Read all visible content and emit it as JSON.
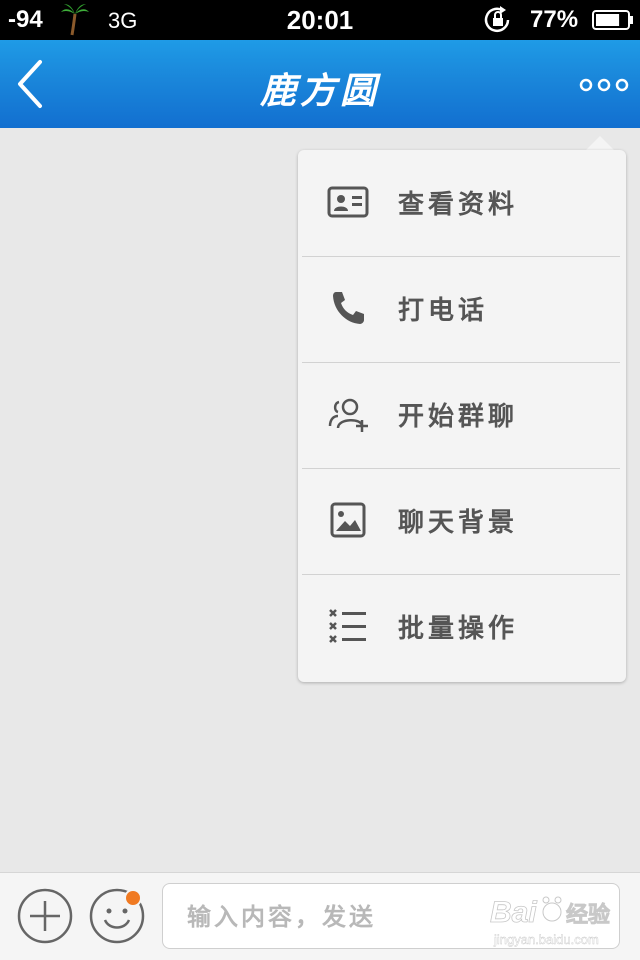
{
  "status_bar": {
    "signal": "-94",
    "network": "3G",
    "time": "20:01",
    "battery": "77%",
    "battery_level": 0.77
  },
  "nav": {
    "title": "鹿方圆",
    "back_icon": "chevron-left-icon",
    "more_icon": "more-dots-icon"
  },
  "menu": {
    "items": [
      {
        "label": "查看资料",
        "icon": "id-card-icon"
      },
      {
        "label": "打电话",
        "icon": "phone-icon"
      },
      {
        "label": "开始群聊",
        "icon": "add-group-icon"
      },
      {
        "label": "聊天背景",
        "icon": "image-icon"
      },
      {
        "label": "批量操作",
        "icon": "batch-list-icon"
      }
    ]
  },
  "input_bar": {
    "placeholder": "输入内容，发送",
    "plus_icon": "plus-circle-icon",
    "emoji_icon": "smiley-icon"
  },
  "watermark": {
    "brand": "Bai",
    "suffix": "经验",
    "url": "jingyan.baidu.com"
  },
  "colors": {
    "nav_top": "#1f9be6",
    "nav_bottom": "#126fd0",
    "badge": "#f07a22",
    "menu_text": "#555555"
  }
}
